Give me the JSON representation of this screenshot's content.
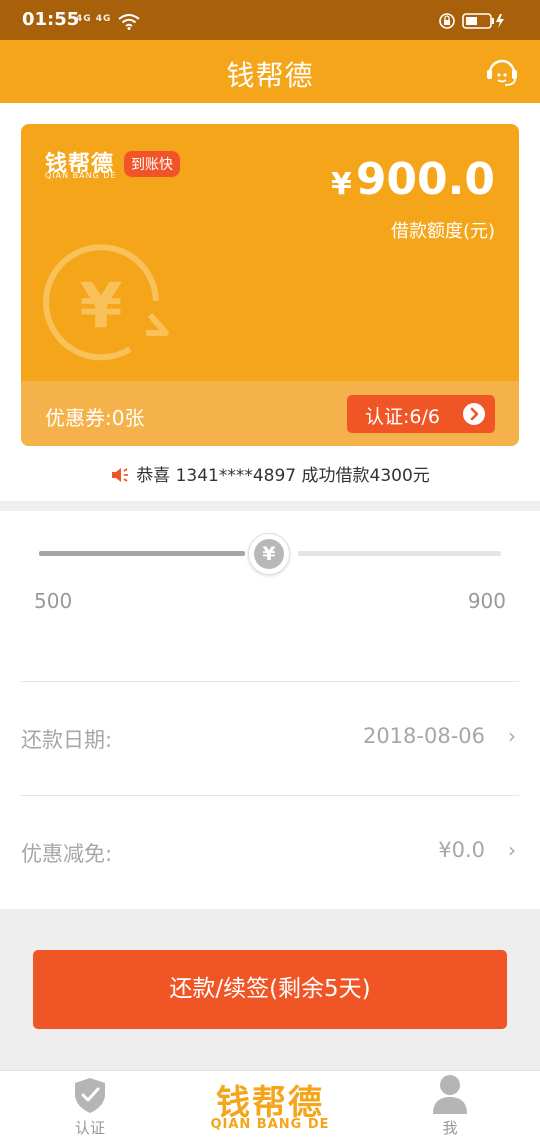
{
  "status_bar": {
    "time": "01:55",
    "signal": "4G 4G"
  },
  "header": {
    "title": "钱帮德"
  },
  "card": {
    "logo": "钱帮德",
    "logo_sub": "QIAN BANG DE",
    "badge": "到账快",
    "currency": "¥",
    "amount": "900.0",
    "amount_label": "借款额度(元)",
    "emblem_symbol": "¥",
    "coupon_text": "优惠券:0张",
    "cert_label": "认证:6/6"
  },
  "notice": {
    "text": "恭喜 1341****4897 成功借款4300元"
  },
  "slider": {
    "min_label": "500",
    "max_label": "900",
    "thumb_symbol": "¥",
    "min": 500,
    "max": 900,
    "value": 700
  },
  "repay_date": {
    "label": "还款日期:",
    "value": "2018-08-06",
    "chevron": "›"
  },
  "discount": {
    "label": "优惠减免:",
    "value": "¥0.0",
    "chevron": "›"
  },
  "action": {
    "label": "还款/续签(剩余5天)"
  },
  "nav": {
    "left_label": "认证",
    "brand": "钱帮德",
    "brand_sub": "QIAN BANG DE",
    "right_label": "我"
  },
  "colors": {
    "accent": "#f5a519",
    "primary": "#f05525",
    "muted": "#a7a7a7"
  }
}
